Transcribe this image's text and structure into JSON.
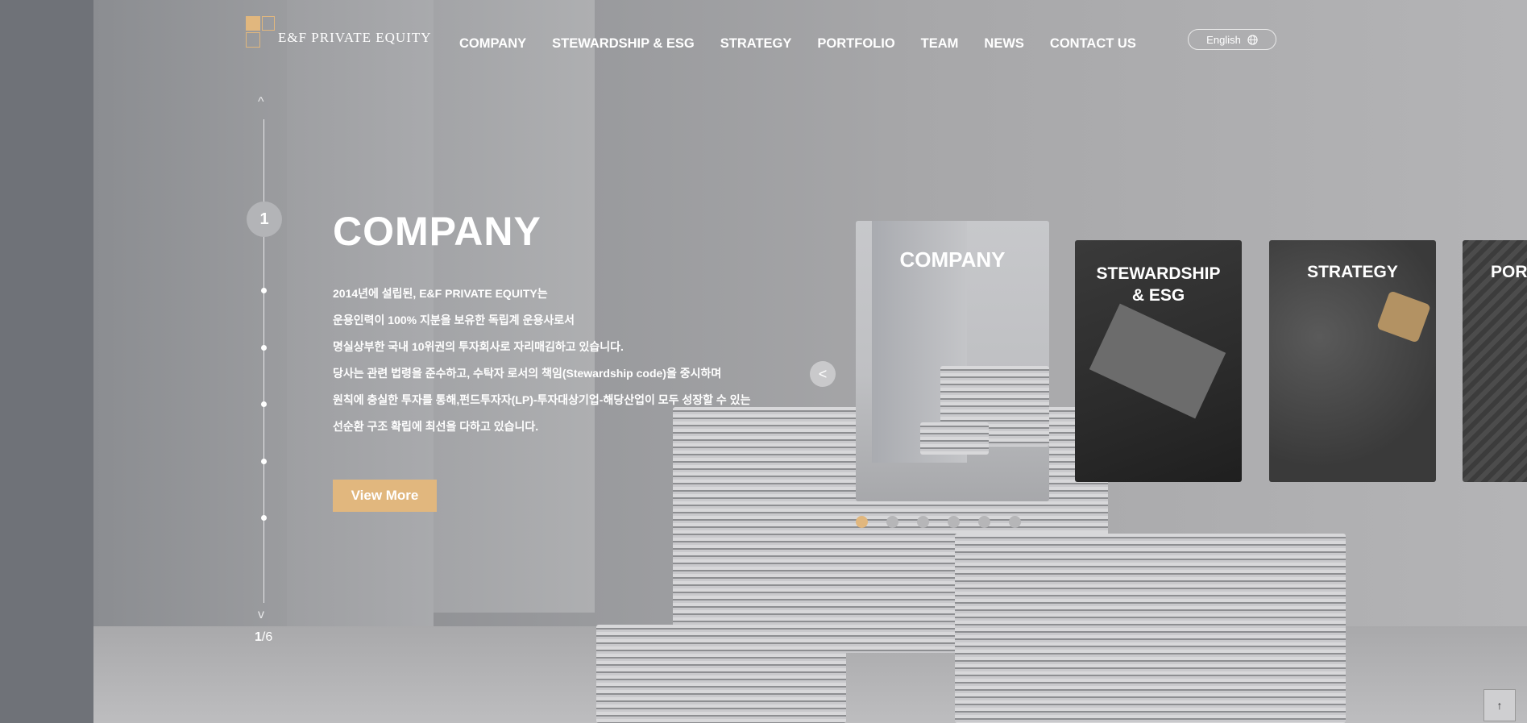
{
  "header": {
    "logo_text": "E&F PRIVATE EQUITY",
    "nav": [
      "COMPANY",
      "STEWARDSHIP & ESG",
      "STRATEGY",
      "PORTFOLIO",
      "TEAM",
      "NEWS",
      "CONTACT US"
    ],
    "language": "English"
  },
  "pager": {
    "up_arrow": "^",
    "down_arrow": "v",
    "active": "1",
    "current": "1",
    "total": "/6"
  },
  "hero": {
    "title": "COMPANY",
    "description": [
      "2014년에 설립된, E&F PRIVATE EQUITY는",
      "운용인력이 100% 지분을 보유한 독립계 운용사로서",
      "명실상부한 국내 10위권의 투자회사로 자리매김하고 있습니다.",
      "당사는 관련 법령을 준수하고, 수탁자 로서의 책임(Stewardship code)을 중시하며",
      "원칙에 충실한 투자를 통해,펀드투자자(LP)-투자대상기업-해당산업이 모두 성장할 수 있는",
      "선순환 구조 확립에 최선을 다하고 있습니다."
    ],
    "button": "View More"
  },
  "slider": {
    "prev": "<",
    "cards": [
      "COMPANY",
      "STEWARDSHIP & ESG",
      "STRATEGY",
      "POR"
    ],
    "card_stew_lines": [
      "STEWARDSHIP",
      "& ESG"
    ],
    "dot_count": 6,
    "active_dot": 1
  },
  "top_button": "↑",
  "colors": {
    "accent": "#e1b77e",
    "text": "#ffffff"
  }
}
